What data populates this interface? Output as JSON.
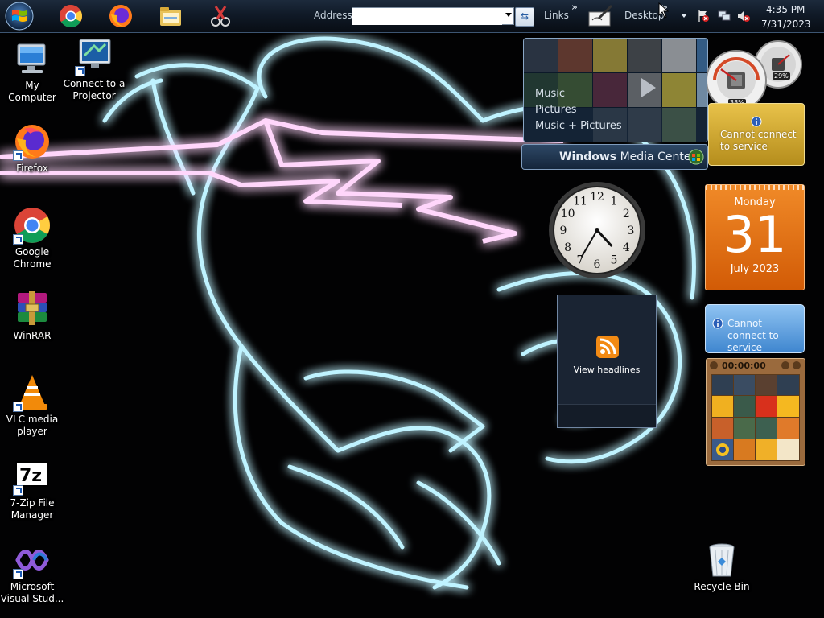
{
  "taskbar": {
    "address_label": "Address",
    "address_value": "",
    "links_label": "Links",
    "desktop_label": "Desktop",
    "time": "4:35 PM",
    "date": "7/31/2023"
  },
  "desktop_icons": [
    {
      "label": "My Computer",
      "icon": "computer-icon"
    },
    {
      "label": "Connect to a Projector",
      "icon": "projector-icon"
    },
    {
      "label": "Firefox",
      "icon": "firefox-icon"
    },
    {
      "label": "Google Chrome",
      "icon": "chrome-icon"
    },
    {
      "label": "WinRAR",
      "icon": "winrar-icon"
    },
    {
      "label": "VLC media player",
      "icon": "vlc-icon"
    },
    {
      "label": "7-Zip File Manager",
      "icon": "7zip-icon"
    },
    {
      "label": "Microsoft Visual Stud...",
      "icon": "visual-studio-icon"
    },
    {
      "label": "Recycle Bin",
      "icon": "recycle-bin-icon"
    }
  ],
  "media_center": {
    "menu": [
      "Music",
      "Pictures",
      "Music + Pictures"
    ],
    "title_bold": "Windows",
    "title_rest": " Media Center"
  },
  "meters": {
    "cpu": "38%",
    "memory": "29%"
  },
  "weather": {
    "message": "Cannot connect to service"
  },
  "calendar": {
    "weekday": "Monday",
    "day": "31",
    "month_year": "July 2023"
  },
  "clock": {
    "hour": 4,
    "minute": 35,
    "numbers": [
      "12",
      "1",
      "2",
      "3",
      "4",
      "5",
      "6",
      "7",
      "8",
      "9",
      "10",
      "11"
    ]
  },
  "feeds": {
    "message": "Cannot connect to service"
  },
  "rss": {
    "label": "View headlines"
  },
  "puzzle": {
    "timer": "00:00:00"
  },
  "colors": {
    "taskbar": "#101a27",
    "calendar": "#e8700f",
    "wallpaper_cyan": "#4fd8ff",
    "wallpaper_magenta": "#ff3df0"
  }
}
